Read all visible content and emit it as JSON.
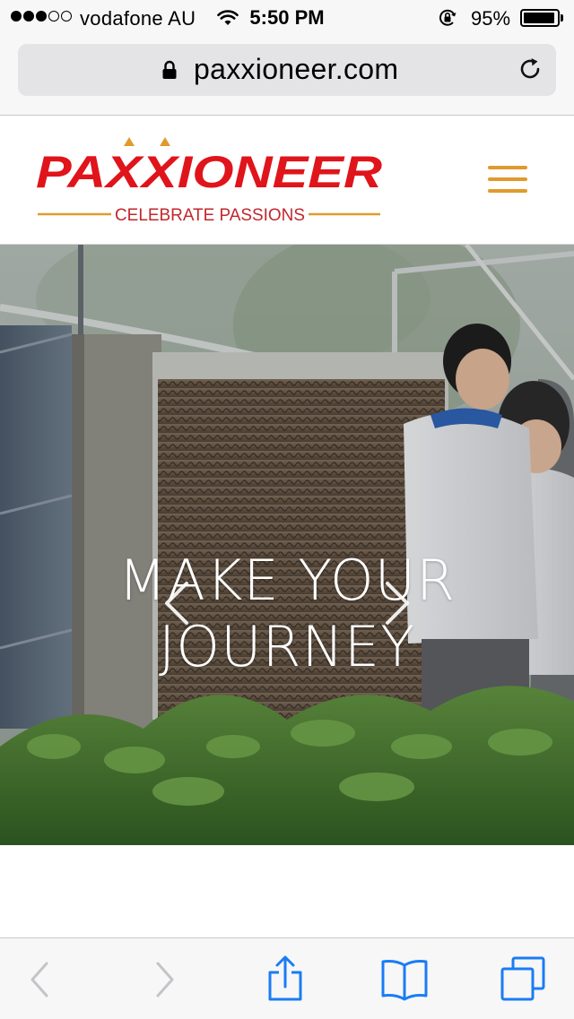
{
  "status_bar": {
    "carrier": "vodafone AU",
    "time": "5:50 PM",
    "battery": "95%",
    "battery_level": 0.95,
    "signal_bars": 3,
    "signal_total": 5
  },
  "browser": {
    "url": "paxxioneer.com"
  },
  "site": {
    "logo_text": "PAXXIONEER",
    "tagline": "CELEBRATE PASSIONS",
    "brand_red": "#e0141b",
    "accent": "#e19a2d"
  },
  "hero": {
    "headline_line1": "MAKE YOUR",
    "headline_line2": "JOURNEY"
  },
  "icons": {
    "status": [
      "signal-dots-icon",
      "wifi-icon",
      "rotation-lock-icon",
      "battery-icon"
    ],
    "url_bar": [
      "padlock-icon",
      "reload-icon"
    ],
    "header": [
      "hamburger-menu-icon"
    ],
    "hero": [
      "chevron-left-icon",
      "chevron-right-icon"
    ],
    "toolbar": [
      "back-icon",
      "forward-icon",
      "share-icon",
      "bookmarks-icon",
      "tabs-icon"
    ]
  }
}
